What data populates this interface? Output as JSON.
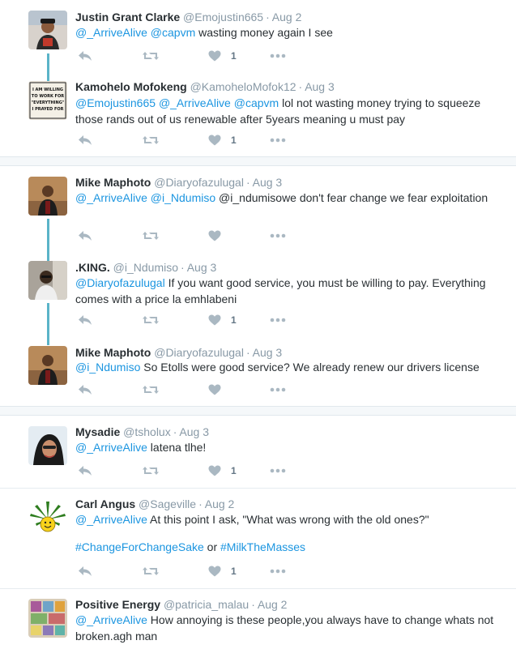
{
  "tweets": [
    {
      "name": "Justin Grant Clarke",
      "handle": "@Emojustin665",
      "time": "Aug 2",
      "text": [
        {
          "t": "@_ArriveAlive",
          "l": true
        },
        {
          "t": " "
        },
        {
          "t": "@capvm",
          "l": true
        },
        {
          "t": " wasting money again I see"
        }
      ],
      "likes": "1"
    },
    {
      "name": "Kamohelo Mofokeng",
      "handle": "@KamoheloMofok12",
      "time": "Aug 3",
      "text": [
        {
          "t": "@Emojustin665",
          "l": true
        },
        {
          "t": " "
        },
        {
          "t": "@_ArriveAlive",
          "l": true
        },
        {
          "t": " "
        },
        {
          "t": "@capvm",
          "l": true
        },
        {
          "t": " lol not wasting money trying to squeeze those rands out of us renewable after 5years meaning u must pay"
        }
      ],
      "likes": "1",
      "avatar_text": [
        "I AM WILLING",
        "TO WORK FOR",
        "\"EVERYTHING\"",
        "I PRAYED FOR"
      ]
    },
    {
      "name": "Mike Maphoto",
      "handle": "@Diaryofazulugal",
      "time": "Aug 3",
      "text": [
        {
          "t": "@_ArriveAlive",
          "l": true
        },
        {
          "t": " "
        },
        {
          "t": "@i_Ndumiso",
          "l": true
        },
        {
          "t": " @i_ndumisowe don't fear change we fear exploitation"
        }
      ],
      "likes": ""
    },
    {
      "name": ".KING.",
      "handle": "@i_Ndumiso",
      "time": "Aug 3",
      "text": [
        {
          "t": "@Diaryofazulugal",
          "l": true
        },
        {
          "t": " If you want good service, you must be willing to pay. Everything comes with a price la emhlabeni"
        }
      ],
      "likes": "1"
    },
    {
      "name": "Mike Maphoto",
      "handle": "@Diaryofazulugal",
      "time": "Aug 3",
      "text": [
        {
          "t": "@i_Ndumiso",
          "l": true
        },
        {
          "t": " So Etolls were good service? We already renew our drivers license"
        }
      ],
      "likes": ""
    },
    {
      "name": "Mysadie",
      "handle": "@tsholux",
      "time": "Aug 3",
      "text": [
        {
          "t": "@_ArriveAlive",
          "l": true
        },
        {
          "t": " latena tlhe!"
        }
      ],
      "likes": "1"
    },
    {
      "name": "Carl Angus",
      "handle": "@Sageville",
      "time": "Aug 2",
      "text": [
        {
          "t": "@_ArriveAlive",
          "l": true
        },
        {
          "t": " At this point I ask, \"What was wrong with the old ones?\""
        },
        {
          "gap": true
        },
        {
          "t": "#ChangeForChangeSake",
          "l": true
        },
        {
          "t": " or "
        },
        {
          "t": "#MilkTheMasses",
          "l": true
        }
      ],
      "likes": "1"
    },
    {
      "name": "Positive Energy",
      "handle": "@patricia_malau",
      "time": "Aug 2",
      "text": [
        {
          "t": "@_ArriveAlive",
          "l": true
        },
        {
          "t": " How annoying is these people,you always have to change whats not broken.agh man"
        }
      ],
      "likes": ""
    }
  ],
  "separator_dot": "·",
  "colors": {
    "link": "#1b95e0",
    "thread": "#5ab4c8",
    "name": "#292f33",
    "meta": "#8899a6",
    "icon": "#aab8c2"
  }
}
